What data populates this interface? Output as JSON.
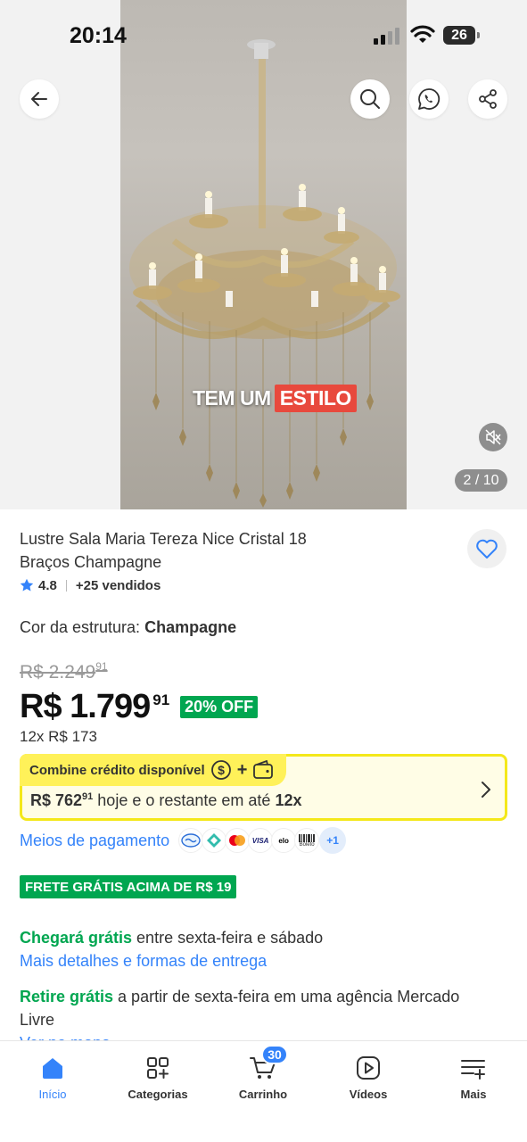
{
  "status_bar": {
    "time": "20:14",
    "battery": "26"
  },
  "media": {
    "caption_part1": "TEM UM",
    "caption_part2": "ESTILO",
    "counter": "2 / 10"
  },
  "icons": {
    "back": "arrow-left-icon",
    "search": "search-icon",
    "whatsapp": "whatsapp-icon",
    "share": "share-icon",
    "mute": "volume-muted-icon",
    "favorite": "heart-icon",
    "star": "star-icon"
  },
  "product": {
    "title": "Lustre Sala Maria Tereza Nice Cristal 18 Braços Champagne",
    "rating": "4.8",
    "sold": "+25 vendidos",
    "variant_label": "Cor da estrutura:",
    "variant_value": "Champagne"
  },
  "pricing": {
    "old_price": "R$ 2.249",
    "old_cents": "91",
    "price": "R$ 1.799",
    "price_cents": "91",
    "discount": "20% OFF",
    "installments": "12x R$ 173"
  },
  "credit": {
    "header": "Combine crédito disponível",
    "plus": "+",
    "amount": "R$ 762",
    "amount_cents": "91",
    "middle_text": " hoje e o restante em até ",
    "term": "12x"
  },
  "payment": {
    "link": "Meios de pagamento",
    "methods": [
      "mercadopago",
      "pix",
      "mastercard",
      "VISA",
      "elo",
      "Boleto"
    ],
    "more": "+1"
  },
  "shipping": {
    "badge": "FRETE GRÁTIS ACIMA DE R$ 19",
    "delivery_highlight": "Chegará grátis",
    "delivery_rest": " entre sexta-feira e sábado",
    "delivery_link": "Mais detalhes e formas de entrega",
    "pickup_highlight": "Retire grátis",
    "pickup_rest": " a partir de sexta-feira em uma agência Mercado Livre",
    "map_link": "Ver no mapa"
  },
  "bottom_nav": {
    "items": [
      {
        "label": "Início",
        "icon": "home-icon"
      },
      {
        "label": "Categorias",
        "icon": "categories-icon"
      },
      {
        "label": "Carrinho",
        "icon": "cart-icon",
        "badge": "30"
      },
      {
        "label": "Vídeos",
        "icon": "video-icon"
      },
      {
        "label": "Mais",
        "icon": "menu-plus-icon"
      }
    ]
  },
  "colors": {
    "accent_blue": "#3483fa",
    "green": "#00a650",
    "yellow": "#fff159",
    "caption_red": "#e8493d"
  }
}
